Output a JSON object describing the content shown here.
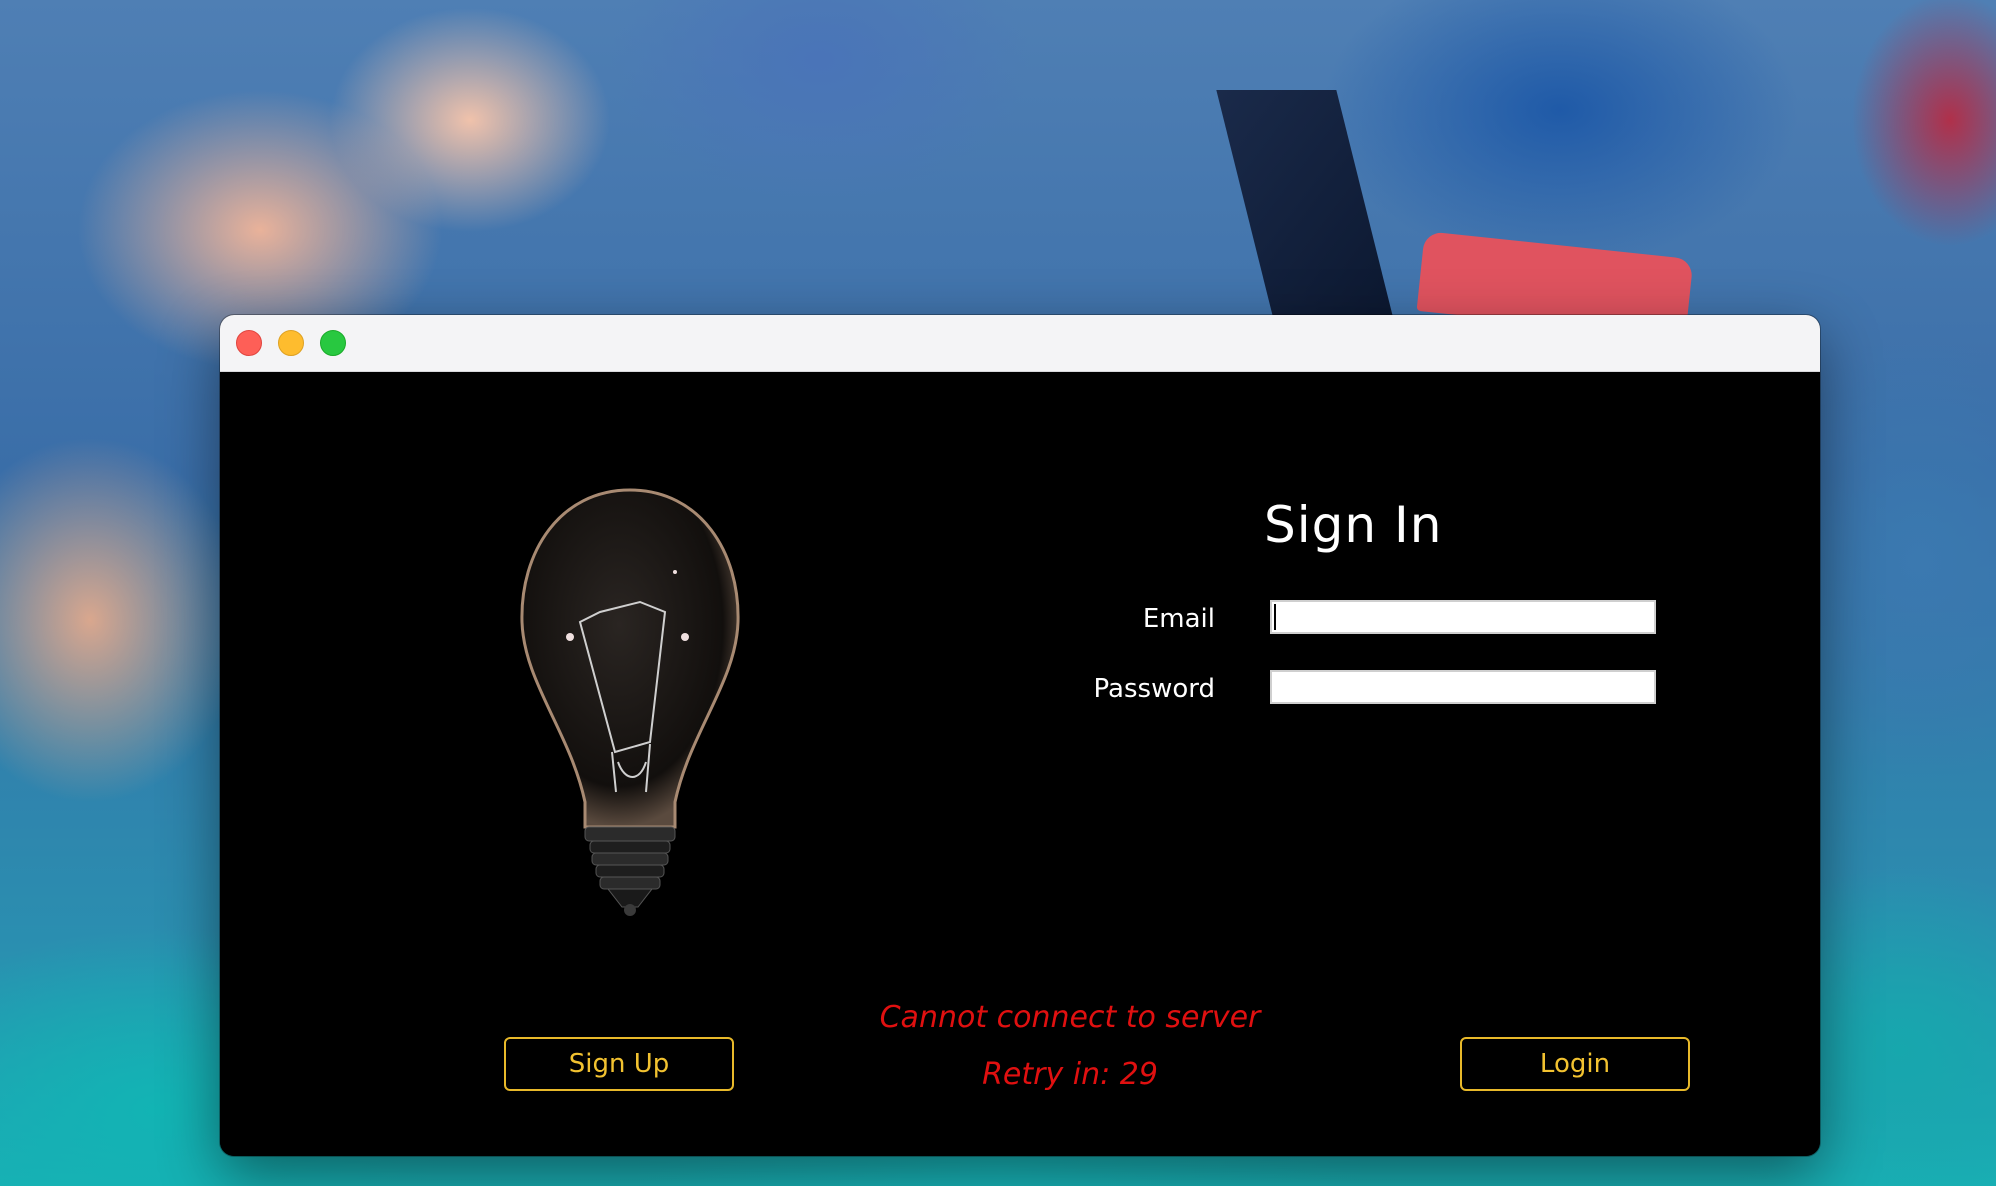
{
  "window": {
    "controls": [
      "close",
      "minimize",
      "maximize"
    ]
  },
  "signin": {
    "title": "Sign In",
    "email_label": "Email",
    "email_value": "",
    "password_label": "Password",
    "password_value": ""
  },
  "buttons": {
    "signup_label": "Sign Up",
    "login_label": "Login"
  },
  "status": {
    "error_message": "Cannot connect to server",
    "retry_text": "Retry in: 29"
  },
  "colors": {
    "button_accent": "#e8b92a",
    "error": "#e01010",
    "panel_background": "#000000"
  },
  "icons": {
    "illustration": "light-bulb-icon"
  }
}
